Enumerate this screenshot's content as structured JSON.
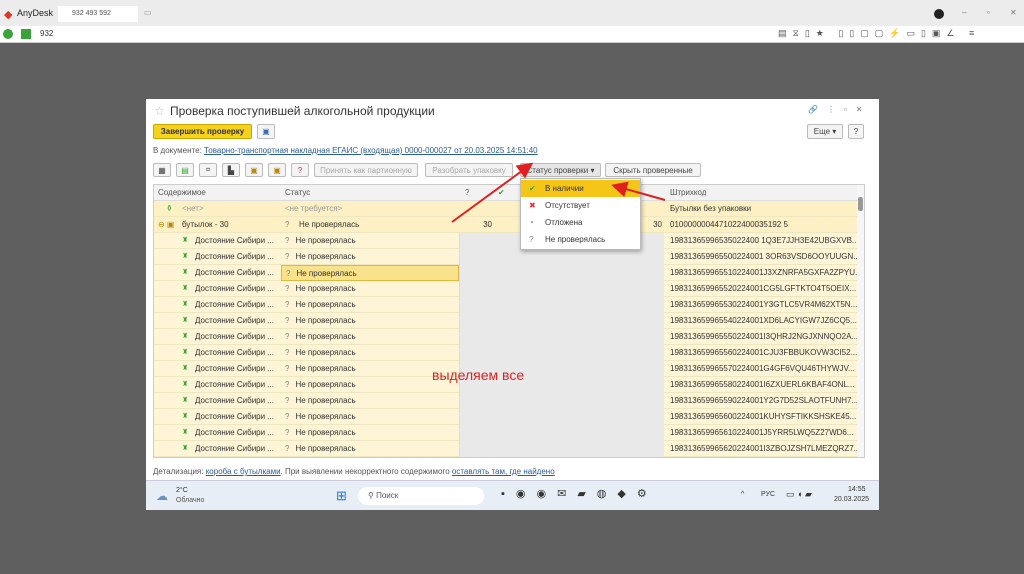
{
  "anydesk": {
    "app": "AnyDesk",
    "tab_id": "932 493 592",
    "address": "932"
  },
  "window": {
    "title": "Проверка поступившей алкогольной продукции"
  },
  "toolbar": {
    "finish": "Завершить проверку",
    "more": "Еще",
    "help": "?",
    "accept_batch": "Принять как партионную",
    "unpack": "Разобрать упаковку",
    "status_check": "Статус проверки",
    "hide_checked": "Скрыть проверенные"
  },
  "document": {
    "label": "В документе:",
    "link": "Товарно-транспортная накладная ЕГАИС (входящая) 0000-000027 от 20.03.2025 14:51:40"
  },
  "table": {
    "headers": {
      "content": "Содержимое",
      "status": "Статус",
      "q": "?",
      "barcode": "Штрихкод"
    },
    "top_rows": [
      {
        "content": "<нет>",
        "status": "<не требуется>",
        "q": "",
        "n": "",
        "barcode": "Бутылки без упаковки"
      },
      {
        "content": "бутылок - 30",
        "status": "Не проверялась",
        "q": "30",
        "n": "30",
        "barcode": "0100000004471022400035192 5"
      }
    ],
    "item_name": "Достояние Сибири ...",
    "item_status": "Не проверялась",
    "barcodes": [
      "19831365996535022400 1Q3E7JJH3E42UBGXVB...",
      "198313659965500224001 3OR63VSD6OOYUUGN...",
      "198313659965510224001J3XZNRFA5GXFA2ZPYU...",
      "198313659965520224001CG5LGFTKTO4T5OEIX...",
      "198313659965530224001Y3GTLC5VR4M62XT5N...",
      "198313659965540224001XD6LACYIGW7JZ6CQ5...",
      "198313659965550224001I3QHRJ2NGJXNNQO2A...",
      "198313659965560224001CJU3FBBUKOVW3CI52...",
      "198313659965570224001G4GF6VQU46THYWJV...",
      "198313659965580224001I6ZXUERL6KBAF4ONL...",
      "198313659965590224001Y2G7D52SLAOTFUNH7...",
      "198313659965600224001KUHYSFTIKKSHSKE45...",
      "198313659965610224001J5YRR5LWQ5Z27WD6...",
      "198313659965620224001I3ZBOJZSH7LMEZQRZ7..."
    ]
  },
  "menu": {
    "items": [
      {
        "label": "В наличии",
        "icon": "check"
      },
      {
        "label": "Отсутствует",
        "icon": "x"
      },
      {
        "label": "Отложена",
        "icon": "clock"
      },
      {
        "label": "Не проверялась",
        "icon": "?"
      }
    ]
  },
  "annotation": "выделяем все",
  "footer": {
    "prefix": "Детализация:",
    "link1": "короба с бутылками",
    "middle": ". При выявлении некорректного содержимого",
    "link2": "оставлять там, где найдено"
  },
  "taskbar": {
    "temp": "2°C",
    "weather": "Облачно",
    "search": "Поиск",
    "lang": "РУС",
    "time": "14:55",
    "date": "20.03.2025"
  },
  "colors": {
    "accent": "#f5d21c",
    "row": "#fdf5d6",
    "selected": "#f9e28c"
  }
}
